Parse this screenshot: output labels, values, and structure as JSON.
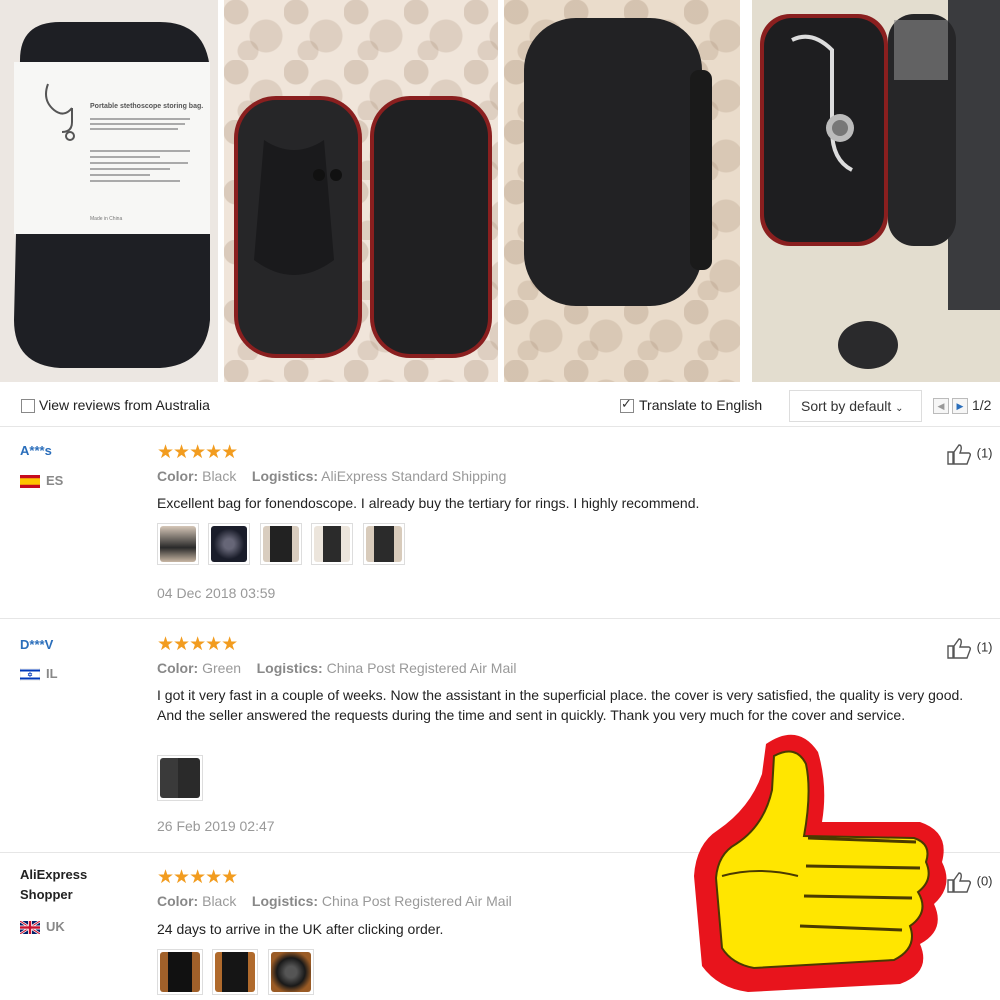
{
  "photos": [
    "package-photo",
    "open-empty-case-photo",
    "closed-case-photo",
    "case-with-stethoscope-photo"
  ],
  "packaging_text": {
    "title": "Portable stethoscope storing bag.",
    "made_in": "Made in China"
  },
  "filters": {
    "view_reviews_label": "View reviews from Australia",
    "view_reviews_checked": false,
    "translate_label": "Translate to English",
    "translate_checked": true,
    "sort_label": "Sort by default",
    "page": "1/2"
  },
  "reviews": [
    {
      "user": "A***s",
      "country": "ES",
      "rating": 5,
      "color_label": "Color:",
      "color": "Black",
      "logistics_label": "Logistics:",
      "logistics": "AliExpress Standard Shipping",
      "text": "Excellent bag for fonendoscope. I already buy the tertiary for rings. I highly recommend.",
      "date": "04 Dec 2018 03:59",
      "likes": "(1)",
      "thumbs": 5
    },
    {
      "user": "D***V",
      "country": "IL",
      "rating": 5,
      "color_label": "Color:",
      "color": "Green",
      "logistics_label": "Logistics:",
      "logistics": "China Post Registered Air Mail",
      "text": "I got it very fast in a couple of weeks. Now the assistant in the superficial place. the cover is very satisfied, the quality is very good. And the seller answered the requests during the time and sent in quickly. Thank you very much for the cover and service.",
      "date": "26 Feb 2019 02:47",
      "likes": "(1)",
      "thumbs": 1
    },
    {
      "user": "AliExpress Shopper",
      "country": "UK",
      "rating": 5,
      "color_label": "Color:",
      "color": "Black",
      "logistics_label": "Logistics:",
      "logistics": "China Post Registered Air Mail",
      "text": "24 days to arrive in the UK after clicking order.",
      "likes": "(0)",
      "thumbs": 3
    }
  ],
  "stars_text": "★★★★★",
  "colors": {
    "link": "#2a6ebb",
    "star": "#f29c1f",
    "thumbs_up_yellow": "#ffe600",
    "thumbs_up_red": "#e8141c"
  }
}
